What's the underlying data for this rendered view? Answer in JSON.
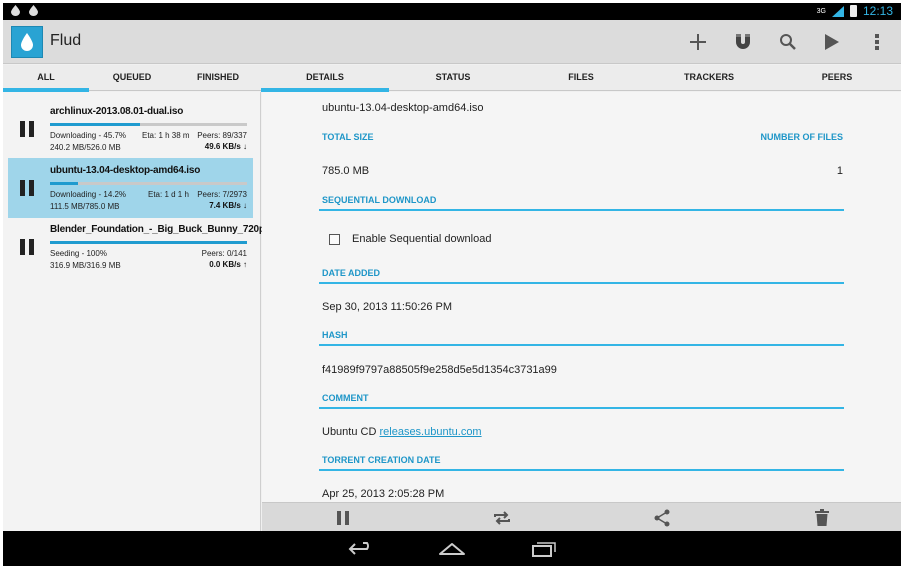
{
  "status_bar": {
    "left_icons": [
      "flud-drop-icon",
      "flud-drop-icon"
    ],
    "signal_label": "3G",
    "time": "12:13"
  },
  "action_bar": {
    "app_title": "Flud",
    "actions": [
      "add-icon",
      "magnet-icon",
      "search-icon",
      "play-icon",
      "overflow-menu-icon"
    ]
  },
  "left_tabs": [
    {
      "label": "ALL",
      "selected": true
    },
    {
      "label": "QUEUED",
      "selected": false
    },
    {
      "label": "FINISHED",
      "selected": false
    }
  ],
  "right_tabs": [
    {
      "label": "DETAILS",
      "selected": true
    },
    {
      "label": "STATUS",
      "selected": false
    },
    {
      "label": "FILES",
      "selected": false
    },
    {
      "label": "TRACKERS",
      "selected": false
    },
    {
      "label": "PEERS",
      "selected": false
    }
  ],
  "torrents": [
    {
      "name": "archlinux-2013.08.01-dual.iso",
      "progress": 0.457,
      "status": "Downloading - 45.7%",
      "eta": "Eta: 1 h 38 m",
      "peers": "Peers: 89/337",
      "size": "240.2 MB/526.0 MB",
      "speed": "49.6 KB/s ↓",
      "selected": false
    },
    {
      "name": "ubuntu-13.04-desktop-amd64.iso",
      "progress": 0.142,
      "status": "Downloading - 14.2%",
      "eta": "Eta: 1 d 1 h",
      "peers": "Peers: 7/2973",
      "size": "111.5 MB/785.0 MB",
      "speed": "7.4 KB/s ↓",
      "selected": true
    },
    {
      "name": "Blender_Foundation_-_Big_Buck_Bunny_720p",
      "progress": 1.0,
      "status": "Seeding - 100%",
      "eta": "",
      "peers": "Peers: 0/141",
      "size": "316.9 MB/316.9 MB",
      "speed": "0.0 KB/s ↑",
      "selected": false
    }
  ],
  "details": {
    "torrent_name": "ubuntu-13.04-desktop-amd64.iso",
    "total_size_label": "TOTAL SIZE",
    "number_of_files_label": "NUMBER OF FILES",
    "total_size": "785.0 MB",
    "number_of_files": "1",
    "sequential_label": "SEQUENTIAL DOWNLOAD",
    "sequential_checkbox_label": "Enable Sequential download",
    "sequential_enabled": false,
    "date_added_label": "DATE ADDED",
    "date_added": "Sep 30, 2013 11:50:26 PM",
    "hash_label": "HASH",
    "hash": "f41989f9797a88505f9e258d5e5d1354c3731a99",
    "comment_label": "COMMENT",
    "comment_prefix": "Ubuntu CD",
    "comment_link": "releases.ubuntu.com",
    "creation_date_label": "TORRENT CREATION DATE",
    "creation_date": "Apr 25, 2013 2:05:28 PM"
  },
  "bottom_actions": [
    "pause-icon",
    "recheck-icon",
    "share-icon",
    "delete-icon"
  ],
  "nav_bar": [
    "back-icon",
    "home-icon",
    "recent-apps-icon"
  ],
  "colors": {
    "accent": "#33b5e5",
    "selected_row": "#9fd5ea",
    "progress_fill": "#1f9bcf"
  }
}
